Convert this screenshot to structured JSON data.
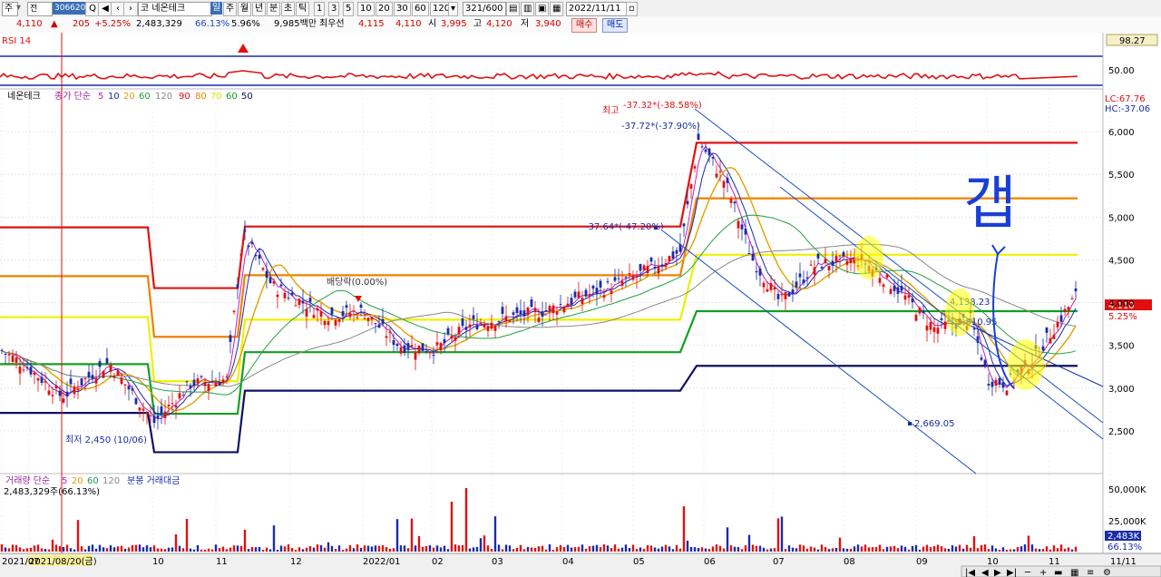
{
  "toolbar": {
    "menu_first": "주",
    "code": "306620",
    "name": "코 네온테크",
    "periods": [
      "일",
      "주",
      "월",
      "년",
      "분",
      "초",
      "틱"
    ],
    "minutes": [
      "1",
      "3",
      "5",
      "10",
      "20",
      "30",
      "60",
      "120"
    ],
    "count": "321/600",
    "date": "2022/11/11"
  },
  "quote": {
    "price": "4,110",
    "change": "205",
    "change_pct": "+5.25%",
    "volume": "2,483,329",
    "vol_ratio": "66.13%",
    "turnover": "5.96%",
    "amount": "9,985백만",
    "best_label": "최우선",
    "best": "4,115",
    "bid": "4,110",
    "open_label": "시",
    "open": "3,995",
    "high_label": "고",
    "high": "4,120",
    "low_label": "저",
    "low": "3,940",
    "buy": "매수",
    "sell": "매도"
  },
  "chart_data": {
    "type": "candlestick",
    "rsi_panel": {
      "title": "RSI 14",
      "level_top": "98.27",
      "level_mid": "50.00"
    },
    "price_panel": {
      "legend_name": "네온테크",
      "legend_ma": "종가 단순",
      "legend_periods": [
        "5",
        "10",
        "20",
        "60",
        "120",
        "90",
        "80",
        "70",
        "60",
        "50"
      ],
      "y_ticks": [
        "6,000",
        "5,500",
        "5,000",
        "4,500",
        "4,000",
        "3,500",
        "3,000",
        "2,500"
      ],
      "lc": "LC:67.76",
      "hc": "HC:-37.06",
      "current_price": "4,110",
      "current_pct": "5.25%",
      "annotations": {
        "high": "최고",
        "high_a": "-37.32*(-38.58%)",
        "high_b": "-37.72*(-37.90%)",
        "mid": "-37.64*(-47.20%)",
        "dividend": "배당락(0.00%)",
        "low": "최저 2,450 (10/06)",
        "point1": "4,138.23",
        "point2": "3,810.95",
        "point3": "2,669.05",
        "handwriting": "갭"
      },
      "levels": [
        5870,
        5220,
        4560,
        3900,
        3260
      ],
      "ylim": [
        2000,
        6500
      ]
    },
    "volume_panel": {
      "legend": "거래량 단순",
      "legend_periods": [
        "5",
        "20",
        "60",
        "120"
      ],
      "legend_extra": "분봉 거래대금",
      "current": "2,483,329주(66.13%)",
      "y_ticks": [
        "50,000K",
        "25,000K"
      ],
      "current_label": "2,483K",
      "current_pct": "66.13%"
    },
    "x_ticks": [
      "2021/07",
      "2021/08/20(금)",
      "10",
      "11",
      "12",
      "2022/01",
      "02",
      "03",
      "04",
      "05",
      "06",
      "07",
      "08",
      "09",
      "10",
      "11",
      "11/11"
    ]
  }
}
